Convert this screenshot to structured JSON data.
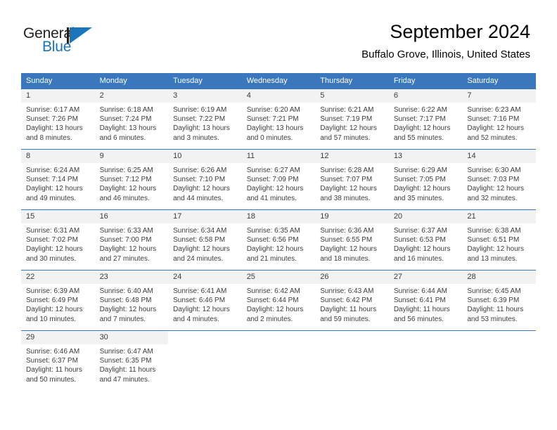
{
  "brand": {
    "name_top": "General",
    "name_bottom": "Blue",
    "accent_color": "#1b75bb",
    "mark_icon": "triangle-flag-icon"
  },
  "header": {
    "month_title": "September 2024",
    "location": "Buffalo Grove, Illinois, United States"
  },
  "calendar": {
    "header_bg": "#3b77bc",
    "daynum_bg": "#f2f2f2",
    "weekdays": [
      "Sunday",
      "Monday",
      "Tuesday",
      "Wednesday",
      "Thursday",
      "Friday",
      "Saturday"
    ],
    "labels": {
      "sunrise": "Sunrise:",
      "sunset": "Sunset:",
      "daylight": "Daylight:"
    },
    "weeks": [
      [
        {
          "day": "1",
          "sunrise": "Sunrise: 6:17 AM",
          "sunset": "Sunset: 7:26 PM",
          "daylight": "Daylight: 13 hours and 8 minutes."
        },
        {
          "day": "2",
          "sunrise": "Sunrise: 6:18 AM",
          "sunset": "Sunset: 7:24 PM",
          "daylight": "Daylight: 13 hours and 6 minutes."
        },
        {
          "day": "3",
          "sunrise": "Sunrise: 6:19 AM",
          "sunset": "Sunset: 7:22 PM",
          "daylight": "Daylight: 13 hours and 3 minutes."
        },
        {
          "day": "4",
          "sunrise": "Sunrise: 6:20 AM",
          "sunset": "Sunset: 7:21 PM",
          "daylight": "Daylight: 13 hours and 0 minutes."
        },
        {
          "day": "5",
          "sunrise": "Sunrise: 6:21 AM",
          "sunset": "Sunset: 7:19 PM",
          "daylight": "Daylight: 12 hours and 57 minutes."
        },
        {
          "day": "6",
          "sunrise": "Sunrise: 6:22 AM",
          "sunset": "Sunset: 7:17 PM",
          "daylight": "Daylight: 12 hours and 55 minutes."
        },
        {
          "day": "7",
          "sunrise": "Sunrise: 6:23 AM",
          "sunset": "Sunset: 7:16 PM",
          "daylight": "Daylight: 12 hours and 52 minutes."
        }
      ],
      [
        {
          "day": "8",
          "sunrise": "Sunrise: 6:24 AM",
          "sunset": "Sunset: 7:14 PM",
          "daylight": "Daylight: 12 hours and 49 minutes."
        },
        {
          "day": "9",
          "sunrise": "Sunrise: 6:25 AM",
          "sunset": "Sunset: 7:12 PM",
          "daylight": "Daylight: 12 hours and 46 minutes."
        },
        {
          "day": "10",
          "sunrise": "Sunrise: 6:26 AM",
          "sunset": "Sunset: 7:10 PM",
          "daylight": "Daylight: 12 hours and 44 minutes."
        },
        {
          "day": "11",
          "sunrise": "Sunrise: 6:27 AM",
          "sunset": "Sunset: 7:09 PM",
          "daylight": "Daylight: 12 hours and 41 minutes."
        },
        {
          "day": "12",
          "sunrise": "Sunrise: 6:28 AM",
          "sunset": "Sunset: 7:07 PM",
          "daylight": "Daylight: 12 hours and 38 minutes."
        },
        {
          "day": "13",
          "sunrise": "Sunrise: 6:29 AM",
          "sunset": "Sunset: 7:05 PM",
          "daylight": "Daylight: 12 hours and 35 minutes."
        },
        {
          "day": "14",
          "sunrise": "Sunrise: 6:30 AM",
          "sunset": "Sunset: 7:03 PM",
          "daylight": "Daylight: 12 hours and 32 minutes."
        }
      ],
      [
        {
          "day": "15",
          "sunrise": "Sunrise: 6:31 AM",
          "sunset": "Sunset: 7:02 PM",
          "daylight": "Daylight: 12 hours and 30 minutes."
        },
        {
          "day": "16",
          "sunrise": "Sunrise: 6:33 AM",
          "sunset": "Sunset: 7:00 PM",
          "daylight": "Daylight: 12 hours and 27 minutes."
        },
        {
          "day": "17",
          "sunrise": "Sunrise: 6:34 AM",
          "sunset": "Sunset: 6:58 PM",
          "daylight": "Daylight: 12 hours and 24 minutes."
        },
        {
          "day": "18",
          "sunrise": "Sunrise: 6:35 AM",
          "sunset": "Sunset: 6:56 PM",
          "daylight": "Daylight: 12 hours and 21 minutes."
        },
        {
          "day": "19",
          "sunrise": "Sunrise: 6:36 AM",
          "sunset": "Sunset: 6:55 PM",
          "daylight": "Daylight: 12 hours and 18 minutes."
        },
        {
          "day": "20",
          "sunrise": "Sunrise: 6:37 AM",
          "sunset": "Sunset: 6:53 PM",
          "daylight": "Daylight: 12 hours and 16 minutes."
        },
        {
          "day": "21",
          "sunrise": "Sunrise: 6:38 AM",
          "sunset": "Sunset: 6:51 PM",
          "daylight": "Daylight: 12 hours and 13 minutes."
        }
      ],
      [
        {
          "day": "22",
          "sunrise": "Sunrise: 6:39 AM",
          "sunset": "Sunset: 6:49 PM",
          "daylight": "Daylight: 12 hours and 10 minutes."
        },
        {
          "day": "23",
          "sunrise": "Sunrise: 6:40 AM",
          "sunset": "Sunset: 6:48 PM",
          "daylight": "Daylight: 12 hours and 7 minutes."
        },
        {
          "day": "24",
          "sunrise": "Sunrise: 6:41 AM",
          "sunset": "Sunset: 6:46 PM",
          "daylight": "Daylight: 12 hours and 4 minutes."
        },
        {
          "day": "25",
          "sunrise": "Sunrise: 6:42 AM",
          "sunset": "Sunset: 6:44 PM",
          "daylight": "Daylight: 12 hours and 2 minutes."
        },
        {
          "day": "26",
          "sunrise": "Sunrise: 6:43 AM",
          "sunset": "Sunset: 6:42 PM",
          "daylight": "Daylight: 11 hours and 59 minutes."
        },
        {
          "day": "27",
          "sunrise": "Sunrise: 6:44 AM",
          "sunset": "Sunset: 6:41 PM",
          "daylight": "Daylight: 11 hours and 56 minutes."
        },
        {
          "day": "28",
          "sunrise": "Sunrise: 6:45 AM",
          "sunset": "Sunset: 6:39 PM",
          "daylight": "Daylight: 11 hours and 53 minutes."
        }
      ],
      [
        {
          "day": "29",
          "sunrise": "Sunrise: 6:46 AM",
          "sunset": "Sunset: 6:37 PM",
          "daylight": "Daylight: 11 hours and 50 minutes."
        },
        {
          "day": "30",
          "sunrise": "Sunrise: 6:47 AM",
          "sunset": "Sunset: 6:35 PM",
          "daylight": "Daylight: 11 hours and 47 minutes."
        },
        {
          "day": "",
          "sunrise": "",
          "sunset": "",
          "daylight": ""
        },
        {
          "day": "",
          "sunrise": "",
          "sunset": "",
          "daylight": ""
        },
        {
          "day": "",
          "sunrise": "",
          "sunset": "",
          "daylight": ""
        },
        {
          "day": "",
          "sunrise": "",
          "sunset": "",
          "daylight": ""
        },
        {
          "day": "",
          "sunrise": "",
          "sunset": "",
          "daylight": ""
        }
      ]
    ]
  }
}
